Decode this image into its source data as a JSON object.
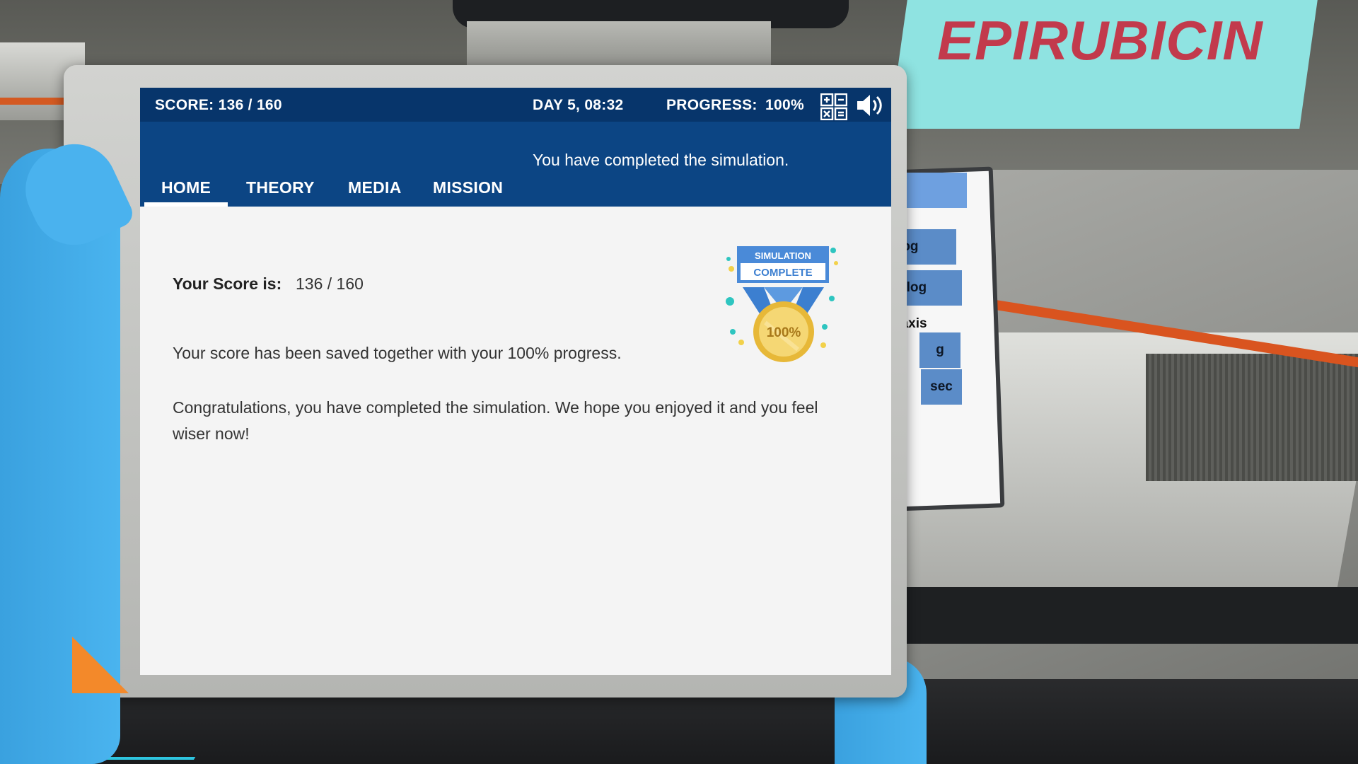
{
  "scene": {
    "drug_label": "EPIRUBICIN",
    "side_tablet": {
      "items": [
        "log",
        "- log",
        "/-axis",
        "g",
        "sec"
      ]
    }
  },
  "topbar": {
    "score": "SCORE: 136 / 160",
    "day_time": "DAY 5, 08:32",
    "progress_label": "PROGRESS:",
    "progress_value": "100%",
    "icons": [
      "grid-menu-icon",
      "speaker-icon"
    ]
  },
  "nav": {
    "status_message": "You have completed the simulation.",
    "tabs": [
      {
        "label": "HOME",
        "active": true
      },
      {
        "label": "THEORY",
        "active": false
      },
      {
        "label": "MEDIA",
        "active": false
      },
      {
        "label": "MISSION",
        "active": false
      }
    ]
  },
  "content": {
    "score_label": "Your Score is:",
    "score_value": "136 / 160",
    "saved_text": "Your score has been saved together with your 100% progress.",
    "congrats_text": "Congratulations, you have completed the simulation. We hope you enjoyed it and you feel wiser now!"
  },
  "badge": {
    "line1": "SIMULATION",
    "line2": "COMPLETE",
    "medal_text": "100%"
  },
  "colors": {
    "topbar": "#07356b",
    "navbar": "#0c4584",
    "screen_bg": "#f4f4f4",
    "glove": "#4ab2ee",
    "label_sign": "#8fe3e1",
    "label_text": "#c23a4c"
  }
}
